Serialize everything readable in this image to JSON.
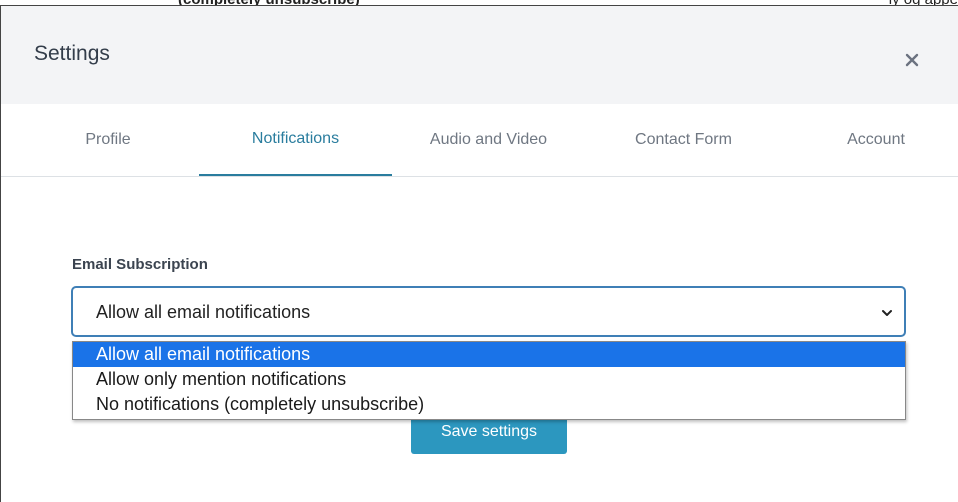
{
  "top_strip": {
    "text": "(completely unsubscribe)",
    "right_text": "ly og appe"
  },
  "modal": {
    "title": "Settings"
  },
  "tabs": [
    {
      "label": "Profile",
      "active": false
    },
    {
      "label": "Notifications",
      "active": true
    },
    {
      "label": "Audio and Video",
      "active": false
    },
    {
      "label": "Contact Form",
      "active": false
    },
    {
      "label": "Account",
      "active": false
    }
  ],
  "email_subscription": {
    "label": "Email Subscription",
    "selected_value": "Allow all email notifications",
    "options": [
      "Allow all email notifications",
      "Allow only mention notifications",
      "No notifications (completely unsubscribe)"
    ],
    "selected_index": 0
  },
  "save_button": {
    "label": "Save settings"
  },
  "icons": {
    "close": "close-icon",
    "dropdown": "chevron-down-icon"
  },
  "colors": {
    "accent": "#2a7d9e",
    "button": "#2c97bf",
    "selection": "#1a73e8",
    "focus_border": "#3f7fb6"
  }
}
